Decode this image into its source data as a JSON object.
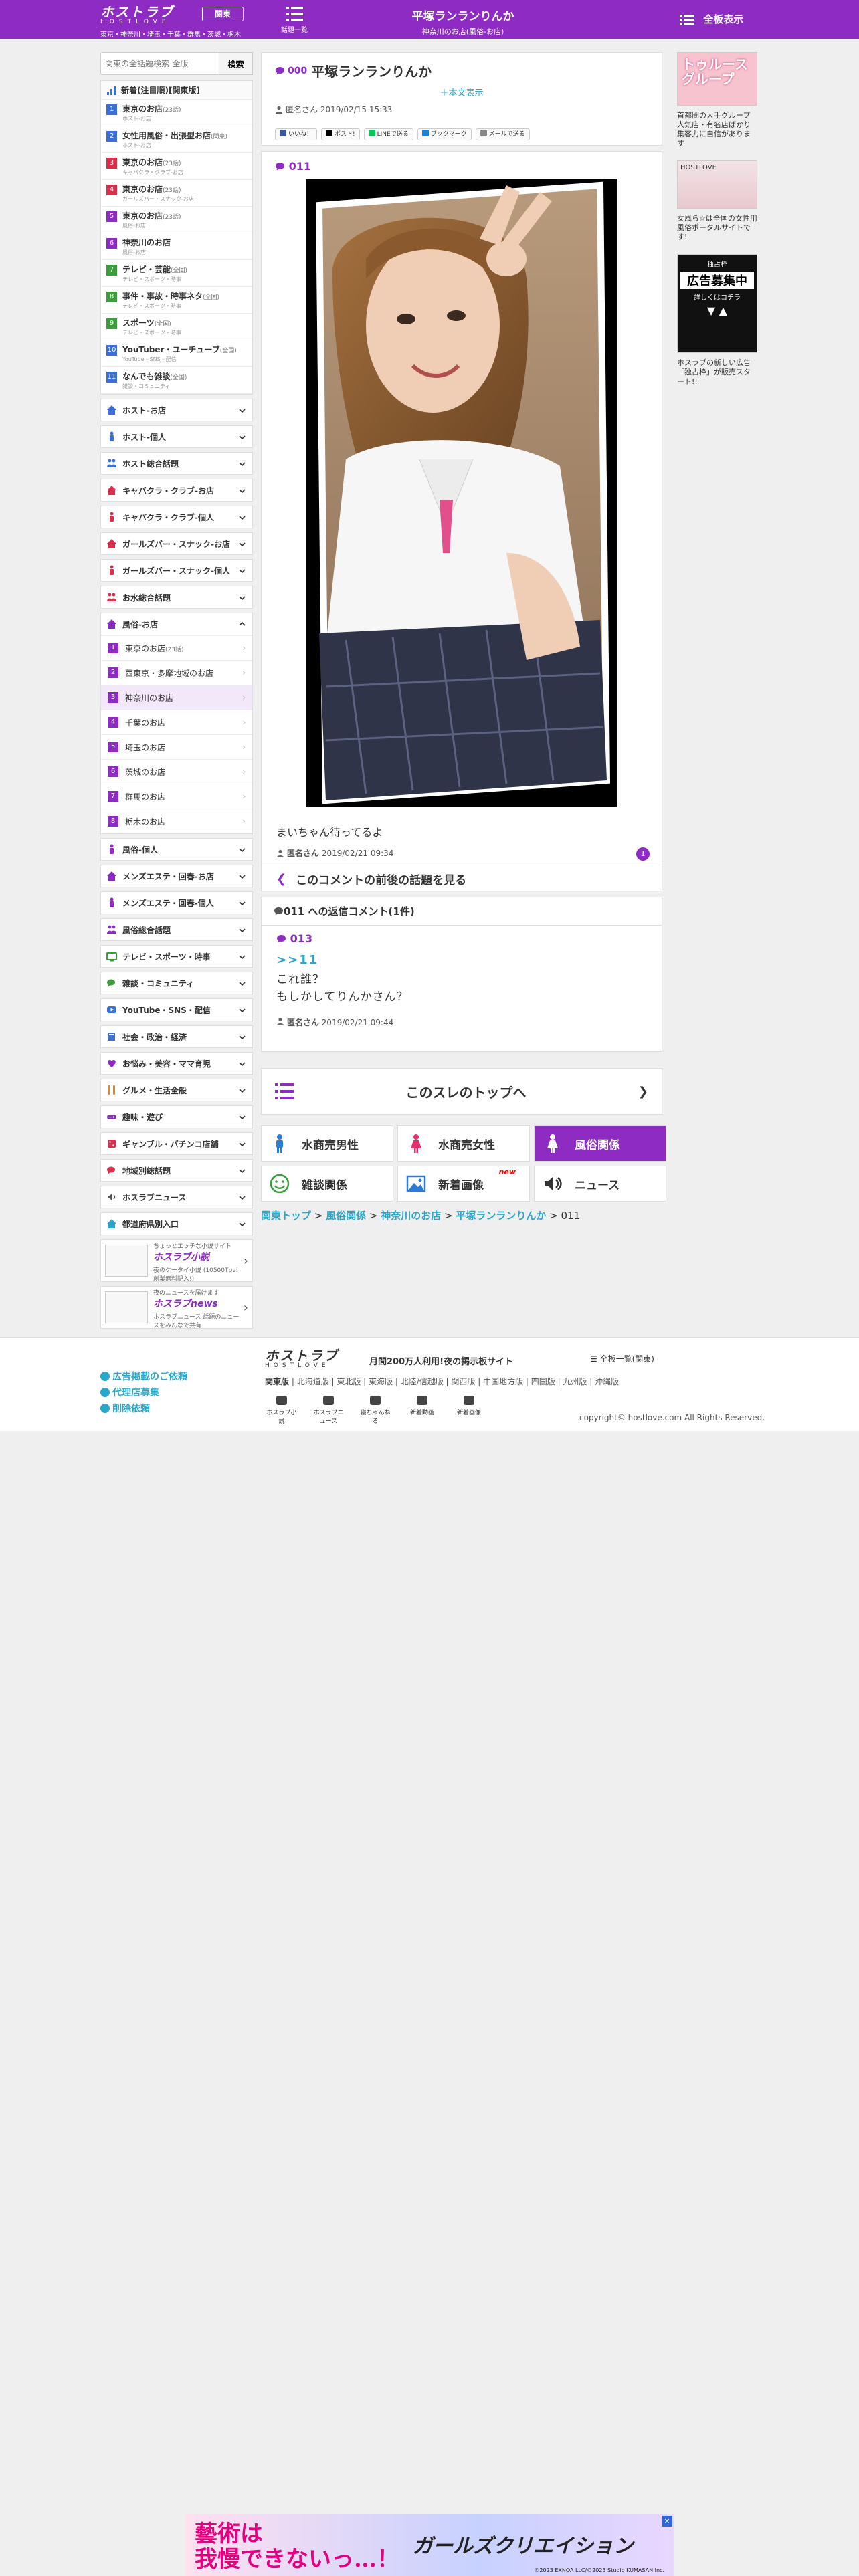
{
  "colors": {
    "brand": "#8d2bc2",
    "link": "#2aa7c9"
  },
  "header": {
    "logo_line1": "ホストラブ",
    "logo_line2": "HOSTLOVE",
    "logo_region": "東京・神奈川・埼玉・千葉・群馬・茨城・栃木",
    "area_label": "関東",
    "menu_label": "話題一覧",
    "title": "平塚ランランりんか",
    "subtitle": "神奈川のお店(風俗-お店)",
    "full_display": "全板表示"
  },
  "sidebar": {
    "search": {
      "placeholder": "関東の全話題検索-全版",
      "button": "検索"
    },
    "ranking_title": "新着(注目順)[関東版]",
    "ranking": [
      {
        "num": "1",
        "name": "東京のお店",
        "count": "(23話)",
        "sub": "ホスト-お店",
        "color": "#3a6fd8"
      },
      {
        "num": "2",
        "name": "女性用風俗・出張型お店",
        "count": "(関東)",
        "sub": "ホスト-お店",
        "color": "#3a6fd8"
      },
      {
        "num": "3",
        "name": "東京のお店",
        "count": "(23話)",
        "sub": "キャバクラ・クラブ-お店",
        "color": "#d8304a"
      },
      {
        "num": "4",
        "name": "東京のお店",
        "count": "(23話)",
        "sub": "ガールズバー・スナック-お店",
        "color": "#d8304a"
      },
      {
        "num": "5",
        "name": "東京のお店",
        "count": "(23話)",
        "sub": "風俗-お店",
        "color": "#8d2bc2"
      },
      {
        "num": "6",
        "name": "神奈川のお店",
        "count": "",
        "sub": "風俗-お店",
        "color": "#8d2bc2"
      },
      {
        "num": "7",
        "name": "テレビ・芸能",
        "count": "(全国)",
        "sub": "テレビ・スポーツ・時事",
        "color": "#3a9e3a"
      },
      {
        "num": "8",
        "name": "事件・事故・時事ネタ",
        "count": "(全国)",
        "sub": "テレビ・スポーツ・時事",
        "color": "#3a9e3a"
      },
      {
        "num": "9",
        "name": "スポーツ",
        "count": "(全国)",
        "sub": "テレビ・スポーツ・時事",
        "color": "#3a9e3a"
      },
      {
        "num": "10",
        "name": "YouTuber・ユーチューブ",
        "count": "(全国)",
        "sub": "YouTube・SNS・配信",
        "color": "#3a6fd8"
      },
      {
        "num": "11",
        "name": "なんでも雑談",
        "count": "(全国)",
        "sub": "雑談・コミュニティ",
        "color": "#3a6fd8"
      }
    ],
    "categories_a": [
      {
        "label": "ホスト-お店",
        "icon": "house-icon",
        "color": "#3a6fd8"
      },
      {
        "label": "ホスト-個人",
        "icon": "person-icon",
        "color": "#3a6fd8"
      },
      {
        "label": "ホスト総合話題",
        "icon": "people-icon",
        "color": "#3a6fd8"
      },
      {
        "label": "キャバクラ・クラブ-お店",
        "icon": "house-icon",
        "color": "#d8304a"
      },
      {
        "label": "キャバクラ・クラブ-個人",
        "icon": "person-icon",
        "color": "#d8304a"
      },
      {
        "label": "ガールズバー・スナック-お店",
        "icon": "house-icon",
        "color": "#d8304a"
      },
      {
        "label": "ガールズバー・スナック-個人",
        "icon": "person-icon",
        "color": "#d8304a"
      },
      {
        "label": "お水総合話題",
        "icon": "people-icon",
        "color": "#d8304a"
      }
    ],
    "fuzoku": {
      "label": "風俗-お店",
      "items": [
        {
          "num": "1",
          "label": "東京のお店",
          "count": "(23話)"
        },
        {
          "num": "2",
          "label": "西東京・多摩地域のお店",
          "count": ""
        },
        {
          "num": "3",
          "label": "神奈川のお店",
          "count": ""
        },
        {
          "num": "4",
          "label": "千葉のお店",
          "count": ""
        },
        {
          "num": "5",
          "label": "埼玉のお店",
          "count": ""
        },
        {
          "num": "6",
          "label": "茨城のお店",
          "count": ""
        },
        {
          "num": "7",
          "label": "群馬のお店",
          "count": ""
        },
        {
          "num": "8",
          "label": "栃木のお店",
          "count": ""
        }
      ]
    },
    "categories_b": [
      {
        "label": "風俗-個人",
        "icon": "person-icon",
        "color": "#8d2bc2"
      },
      {
        "label": "メンズエステ・回春-お店",
        "icon": "house-icon",
        "color": "#8d2bc2"
      },
      {
        "label": "メンズエステ・回春-個人",
        "icon": "person-icon",
        "color": "#8d2bc2"
      },
      {
        "label": "風俗総合話題",
        "icon": "people-icon",
        "color": "#8d2bc2"
      },
      {
        "label": "テレビ・スポーツ・時事",
        "icon": "tv-icon",
        "color": "#3a9e3a"
      },
      {
        "label": "雑談・コミュニティ",
        "icon": "chat-icon",
        "color": "#3a9e3a"
      },
      {
        "label": "YouTube・SNS・配信",
        "icon": "youtube-icon",
        "color": "#3a6fd8"
      },
      {
        "label": "社会・政治・経済",
        "icon": "book-icon",
        "color": "#3a6fd8"
      },
      {
        "label": "お悩み・美容・ママ育児",
        "icon": "heart-icon",
        "color": "#8d2bc2"
      },
      {
        "label": "グルメ・生活全般",
        "icon": "fork-icon",
        "color": "#e08a1e"
      },
      {
        "label": "趣味・遊び",
        "icon": "game-icon",
        "color": "#8d2bc2"
      },
      {
        "label": "ギャンブル・パチンコ店舗",
        "icon": "dice-icon",
        "color": "#d8304a"
      },
      {
        "label": "地域別総話題",
        "icon": "chat-icon",
        "color": "#d8304a"
      },
      {
        "label": "ホスラブニュース",
        "icon": "speaker-icon",
        "color": "#555555"
      },
      {
        "label": "都道府県別入口",
        "icon": "house-icon",
        "color": "#2aa7c9"
      }
    ],
    "banners": [
      {
        "line0": "ちょっとエッチな小説サイト",
        "title": "ホスラブ小説",
        "sub": "夜のケータイ小説 (10500Tpv! 創業無料記入!)"
      },
      {
        "line0": "夜のニュースを届けます",
        "title": "ホスラブnews",
        "sub": "ホスラブニュース 話題のニュースをみんなで共有"
      }
    ]
  },
  "thread": {
    "no": "000",
    "title": "平塚ランランりんか",
    "honbun": "＋本文表示",
    "author": "匿名さん",
    "date": "2019/02/15 15:33",
    "shares": [
      "いいね！",
      "ポスト!",
      "LINEで送る",
      "ブックマーク",
      "メールで送る"
    ]
  },
  "post": {
    "no": "011",
    "text": "まいちゃん待ってるよ",
    "author": "匿名さん",
    "date": "2019/02/21 09:34",
    "replies": "1",
    "around": "このコメントの前後の話題を見る"
  },
  "reply_section": {
    "head": "011 への返信コメント(1件)",
    "no": "013",
    "ref": ">>11",
    "line1": "これ誰？",
    "line2": "もしかしてりんかさん？",
    "author": "匿名さん",
    "date": "2019/02/21 09:44"
  },
  "top_button": "このスレのトップへ",
  "categories_grid": [
    {
      "label": "水商売男性",
      "icon": "man-icon"
    },
    {
      "label": "水商売女性",
      "icon": "woman-icon"
    },
    {
      "label": "風俗関係",
      "icon": "woman-icon"
    },
    {
      "label": "雑談関係",
      "icon": "smile-icon"
    },
    {
      "label": "新着画像",
      "icon": "image-icon",
      "badge": "new"
    },
    {
      "label": "ニュース",
      "icon": "speaker-icon"
    }
  ],
  "breadcrumb": {
    "items": [
      "関東トップ",
      "風俗関係",
      "神奈川のお店",
      "平塚ランランりんか"
    ],
    "current": "011"
  },
  "right_ads": {
    "ad1_title": "トゥルース グループ",
    "ad1_text": "首都圏の大手グループ 人気店・有名店ばかり 集客力に自信があります",
    "ad2_title": "HOSTLOVE",
    "ad2_text": "女風ら☆は全国の女性用風俗ポータルサイトです!",
    "ad3_line1": "独占枠",
    "ad3_line2": "広告募集中",
    "ad3_line3": "詳しくはコチラ",
    "ad3_text": "ホスラブの新しい広告「独占枠」が販売スタート!!"
  },
  "footer": {
    "links": [
      "広告掲載のご依頼",
      "代理店募集",
      "削除依頼"
    ],
    "logo_line1": "ホストラブ",
    "logo_line2": "HOSTLOVE",
    "catch": "月間200万人利用!夜の掲示板サイト",
    "pc": "全板一覧(関東)",
    "areas_label": "関東版",
    "areas": "北海道版 | 東北版 | 東海版 | 北陸/信越版 | 関西版 | 中国地方版 | 四国版 | 九州版 | 沖縄版",
    "icons": [
      "ホスラブ小説",
      "ホスラブニュース",
      "寝ちゃんねる",
      "新着動画",
      "新着画像"
    ],
    "copyright": "copyright© hostlove.com All Rights Reserved."
  },
  "bottom_ad": {
    "line1": "藝術は",
    "line2": "我慢できないっ…！",
    "brand": "ガールズクリエイション",
    "credit": "©2023 EXNOA LLC/©2023 Studio KUMASAN Inc.",
    "close": "×"
  }
}
